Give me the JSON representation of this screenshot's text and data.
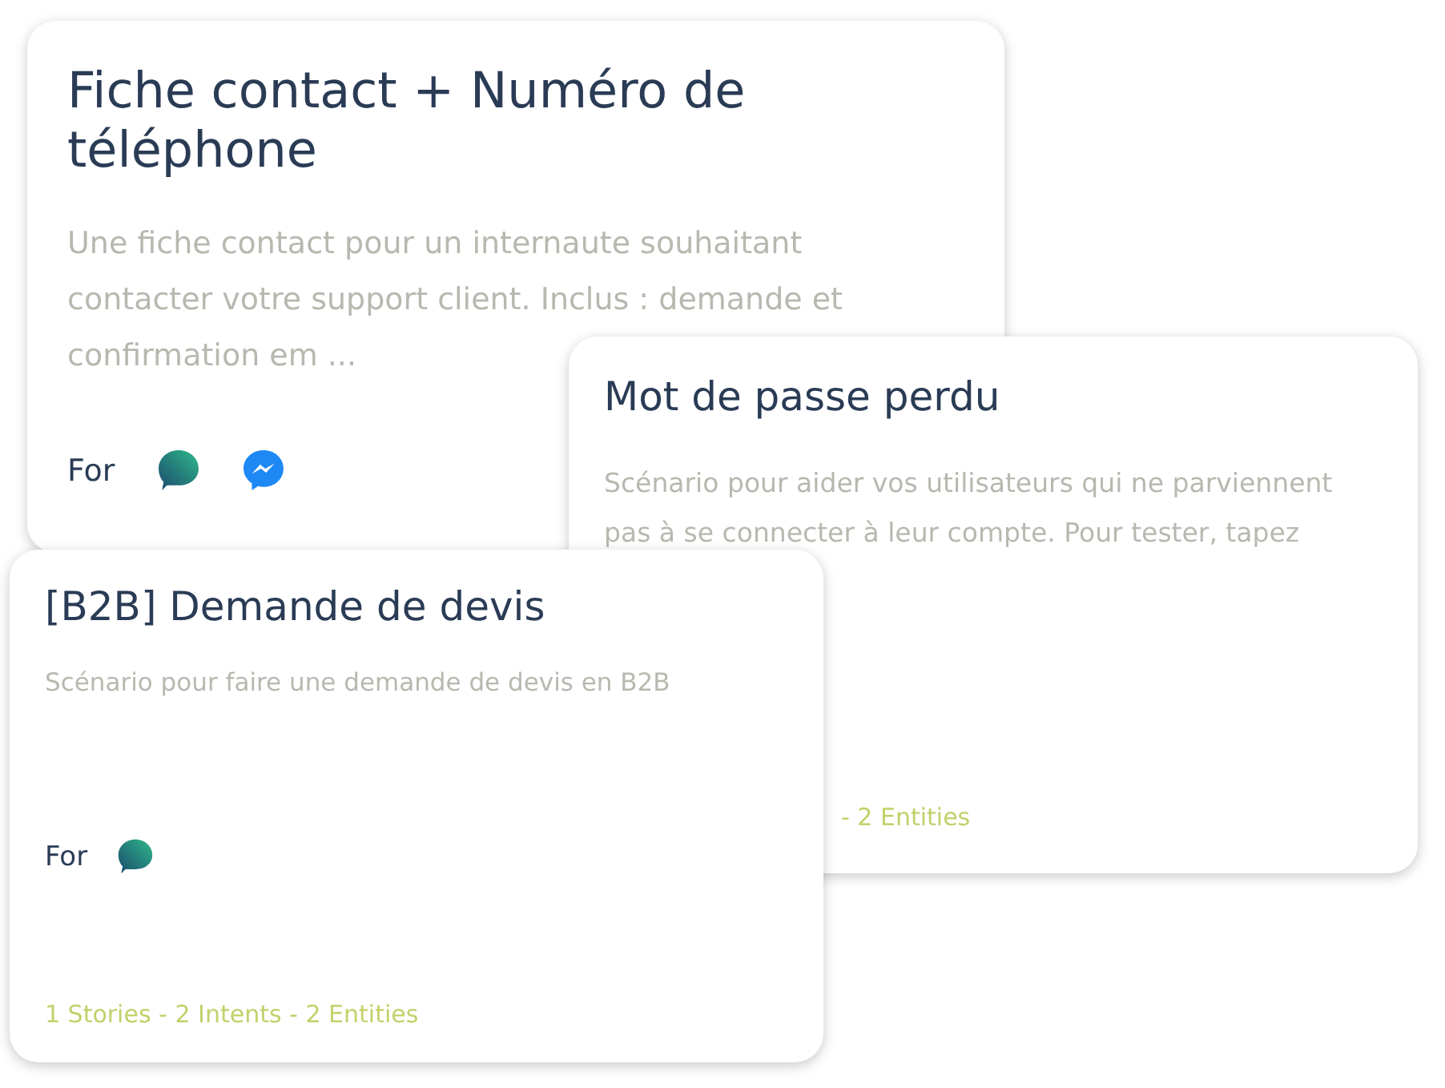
{
  "cards": [
    {
      "title": "Fiche contact + Numéro de téléphone",
      "description": "Une fiche contact pour un internaute souhaitant contacter votre support client. Inclus : demande et confirmation em ...",
      "for_label": "For",
      "channels": [
        {
          "kind": "chat"
        },
        {
          "kind": "messenger"
        }
      ]
    },
    {
      "title": "Mot de passe perdu",
      "description": "Scénario pour aider vos utilisateurs qui ne parviennent pas à se connecter à leur compte. Pour tester, tapez",
      "stats": "- 2 Entities"
    },
    {
      "title": "[B2B] Demande de devis",
      "description": "Scénario pour faire une demande de devis en B2B",
      "for_label": "For",
      "channels": [
        {
          "kind": "chat"
        }
      ],
      "stats": "1 Stories - 2 Intents - 2 Entities"
    }
  ]
}
